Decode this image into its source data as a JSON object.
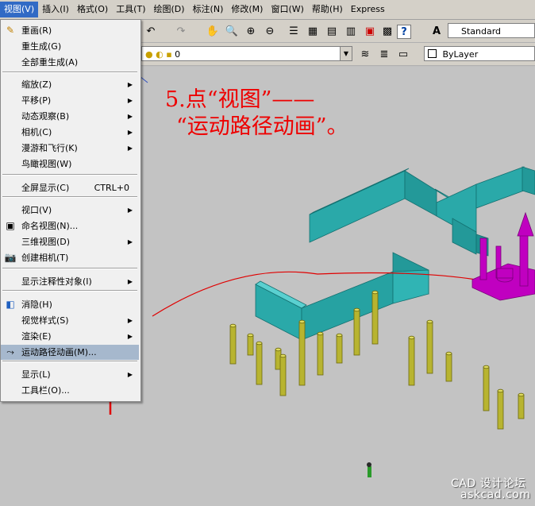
{
  "menubar": [
    {
      "label": "视图(V)",
      "active": true
    },
    {
      "label": "插入(I)"
    },
    {
      "label": "格式(O)"
    },
    {
      "label": "工具(T)"
    },
    {
      "label": "绘图(D)"
    },
    {
      "label": "标注(N)"
    },
    {
      "label": "修改(M)"
    },
    {
      "label": "窗口(W)"
    },
    {
      "label": "帮助(H)"
    },
    {
      "label": "Express"
    }
  ],
  "toolbar": {
    "text_style_value": "Standard",
    "layer_value": "0",
    "linetype_value": "ByLayer"
  },
  "view_menu": {
    "items": [
      {
        "label": "重画(R)",
        "icon": "pencil-icon"
      },
      {
        "label": "重生成(G)"
      },
      {
        "label": "全部重生成(A)"
      },
      {
        "label": "缩放(Z)",
        "submenu": true
      },
      {
        "label": "平移(P)",
        "submenu": true
      },
      {
        "label": "动态观察(B)",
        "submenu": true
      },
      {
        "label": "相机(C)",
        "submenu": true
      },
      {
        "label": "漫游和飞行(K)",
        "submenu": true
      },
      {
        "label": "鸟瞰视图(W)"
      },
      {
        "label": "全屏显示(C)",
        "shortcut": "CTRL+0"
      },
      {
        "label": "视口(V)",
        "submenu": true
      },
      {
        "label": "命名视图(N)...",
        "icon": "named-view-icon"
      },
      {
        "label": "三维视图(D)",
        "submenu": true
      },
      {
        "label": "创建相机(T)",
        "icon": "camera-icon"
      },
      {
        "label": "显示注释性对象(I)",
        "submenu": true
      },
      {
        "label": "消隐(H)",
        "icon": "hide-icon"
      },
      {
        "label": "视觉样式(S)",
        "submenu": true
      },
      {
        "label": "渲染(E)",
        "submenu": true
      },
      {
        "label": "运动路径动画(M)...",
        "icon": "motion-path-icon",
        "highlighted": true
      },
      {
        "label": "显示(L)",
        "submenu": true
      },
      {
        "label": "工具栏(O)..."
      }
    ]
  },
  "annotation": {
    "line1": "5.点“视图”——",
    "line2": "“运动路径动画”。",
    "color": "#e00000"
  },
  "watermark": {
    "line1": "CAD 设计论坛",
    "line2": "askcad.com"
  },
  "colors": {
    "wall": "#2ab0b0",
    "post": "#b8b830",
    "magenta": "#c000c0",
    "path": "#e00000"
  }
}
